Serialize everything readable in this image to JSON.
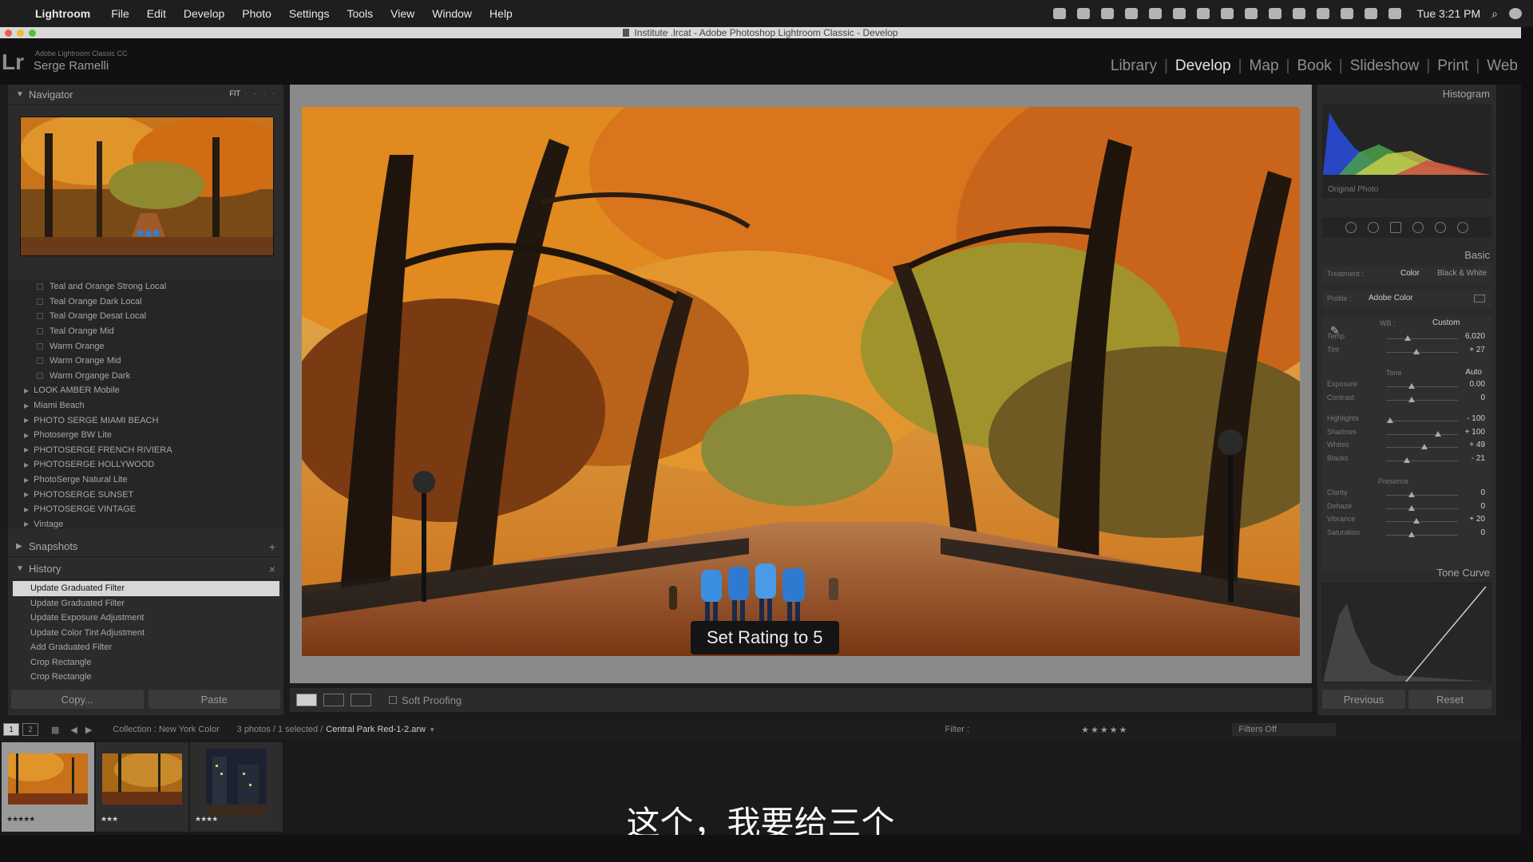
{
  "menubar": {
    "app": "Lightroom",
    "menus": [
      "File",
      "Edit",
      "Develop",
      "Photo",
      "Settings",
      "Tools",
      "View",
      "Window",
      "Help"
    ],
    "clock": "Tue 3:21 PM"
  },
  "window": {
    "title": "Institute .lrcat - Adobe Photoshop Lightroom Classic - Develop"
  },
  "identity": {
    "product": "Adobe Lightroom Classic CC",
    "user": "Serge Ramelli",
    "logo": "Lr"
  },
  "modules": [
    "Library",
    "Develop",
    "Map",
    "Book",
    "Slideshow",
    "Print",
    "Web"
  ],
  "left": {
    "navigator": "Navigator",
    "nav_mode": "FIT",
    "presets": [
      {
        "label": "Teal and Orange Strong Local",
        "type": "item"
      },
      {
        "label": "Teal Orange Dark Local",
        "type": "item"
      },
      {
        "label": "Teal Orange Desat Local",
        "type": "item"
      },
      {
        "label": "Teal Orange Mid",
        "type": "item"
      },
      {
        "label": "Warm Orange",
        "type": "item"
      },
      {
        "label": "Warm Orange Mid",
        "type": "item"
      },
      {
        "label": "Warm Organge Dark",
        "type": "item"
      },
      {
        "label": "LOOK AMBER Mobile",
        "type": "folder"
      },
      {
        "label": "Miami Beach",
        "type": "folder"
      },
      {
        "label": "PHOTO SERGE MIAMI BEACH",
        "type": "folder"
      },
      {
        "label": "Photoserge BW Lite",
        "type": "folder"
      },
      {
        "label": "PHOTOSERGE FRENCH RIVIERA",
        "type": "folder"
      },
      {
        "label": "PHOTOSERGE HOLLYWOOD",
        "type": "folder"
      },
      {
        "label": "PhotoSerge Natural Lite",
        "type": "folder"
      },
      {
        "label": "PHOTOSERGE SUNSET",
        "type": "folder"
      },
      {
        "label": "PHOTOSERGE VINTAGE",
        "type": "folder"
      },
      {
        "label": "Vintage",
        "type": "folder"
      }
    ],
    "snapshots": "Snapshots",
    "history": "History",
    "history_items": [
      "Update Graduated Filter",
      "Update Graduated Filter",
      "Update Exposure Adjustment",
      "Update Color Tint Adjustment",
      "Add Graduated Filter",
      "Crop Rectangle",
      "Crop Rectangle"
    ],
    "copy": "Copy...",
    "paste": "Paste"
  },
  "center": {
    "toast": "Set Rating to 5",
    "soft_proofing": "Soft Proofing"
  },
  "right": {
    "histogram": "Histogram",
    "original_photo": "Original Photo",
    "basic": "Basic",
    "treatment_label": "Treatment :",
    "treatment_color": "Color",
    "treatment_bw": "Black & White",
    "profile_label": "Profile :",
    "profile_value": "Adobe Color",
    "wb_label": "WB :",
    "wb_value": "Custom",
    "tone_label": "Tone",
    "auto": "Auto",
    "presence_label": "Presence",
    "sliders": [
      {
        "label": "Temp",
        "value": "6,020",
        "pos": 0.3
      },
      {
        "label": "Tint",
        "value": "+ 27",
        "pos": 0.42
      },
      {
        "label": "Exposure",
        "value": "0.00",
        "pos": 0.36
      },
      {
        "label": "Contrast",
        "value": "0",
        "pos": 0.36
      },
      {
        "label": "Highlights",
        "value": "- 100",
        "pos": 0.05
      },
      {
        "label": "Shadows",
        "value": "+ 100",
        "pos": 0.72
      },
      {
        "label": "Whites",
        "value": "+ 49",
        "pos": 0.53
      },
      {
        "label": "Blacks",
        "value": "- 21",
        "pos": 0.29
      },
      {
        "label": "Clarity",
        "value": "0",
        "pos": 0.36
      },
      {
        "label": "Dehaze",
        "value": "0",
        "pos": 0.36
      },
      {
        "label": "Vibrance",
        "value": "+ 20",
        "pos": 0.42
      },
      {
        "label": "Saturation",
        "value": "0",
        "pos": 0.36
      }
    ],
    "tone_curve": "Tone Curve",
    "previous": "Previous",
    "reset": "Reset"
  },
  "filmstrip": {
    "pages": [
      "1",
      "2"
    ],
    "collection": "Collection : New York Color",
    "info": "3 photos / 1 selected /",
    "filename": "Central Park Red-1-2.arw",
    "filter_label": "Filter :",
    "filters_off": "Filters Off",
    "thumbs": [
      {
        "stars": "★★★★★",
        "rating": 5,
        "selected": true
      },
      {
        "stars": "★★★",
        "rating": 3,
        "selected": false
      },
      {
        "stars": "★★★★",
        "rating": 4,
        "selected": false
      }
    ]
  },
  "subtitle": "这个，我要给三个",
  "colors": {
    "foliage": "#d9751c",
    "accent_selected": "#d7d7d7",
    "histogram_blue": "#2a4bd6"
  }
}
